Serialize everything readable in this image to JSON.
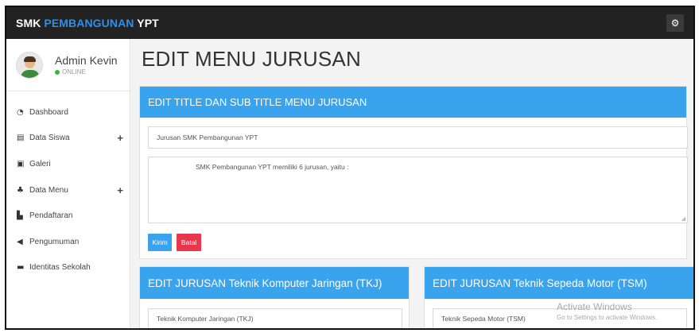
{
  "topbar": {
    "brand_prefix": "SMK ",
    "brand_accent": "PEMBANGUNAN",
    "brand_suffix": " YPT",
    "settings_icon": "gear-icon"
  },
  "user": {
    "name": "Admin Kevin",
    "status": "ONLINE"
  },
  "sidebar": {
    "items": [
      {
        "label": "Dashboard",
        "icon": "dashboard-icon",
        "expandable": false
      },
      {
        "label": "Data Siswa",
        "icon": "database-icon",
        "expandable": true
      },
      {
        "label": "Galeri",
        "icon": "image-icon",
        "expandable": false
      },
      {
        "label": "Data Menu",
        "icon": "sitemap-icon",
        "expandable": true
      },
      {
        "label": "Pendaftaran",
        "icon": "file-icon",
        "expandable": false
      },
      {
        "label": "Pengumuman",
        "icon": "bullhorn-icon",
        "expandable": false
      },
      {
        "label": "Identitas Sekolah",
        "icon": "id-card-icon",
        "expandable": false
      }
    ],
    "plus_label": "+"
  },
  "main": {
    "page_title": "EDIT MENU JURUSAN",
    "title_panel": {
      "heading": "EDIT TITLE DAN SUB TITLE MENU JURUSAN",
      "title_value": "Jurusan SMK Pembangunan YPT",
      "subtitle_value": "SMK Pembangunan YPT memiliki 6 jurusan, yaitu :",
      "submit_label": "Kirim",
      "cancel_label": "Batal"
    },
    "tkj_panel": {
      "heading": "EDIT JURUSAN Teknik Komputer Jaringan (TKJ)",
      "name_value": "Teknik Komputer Jaringan (TKJ)"
    },
    "tsm_panel": {
      "heading": "EDIT JURUSAN Teknik Sepeda Motor (TSM)",
      "name_value": "Teknik Sepeda Motor (TSM)"
    }
  },
  "watermark": {
    "title": "Activate Windows",
    "subtitle": "Go to Settings to activate Windows."
  },
  "colors": {
    "topbar_bg": "#222222",
    "brand_accent": "#2f8fe8",
    "panel_header": "#3aa3ee",
    "btn_submit": "#3aa3ee",
    "btn_cancel": "#e8364b",
    "online_dot": "#3ab53a"
  }
}
